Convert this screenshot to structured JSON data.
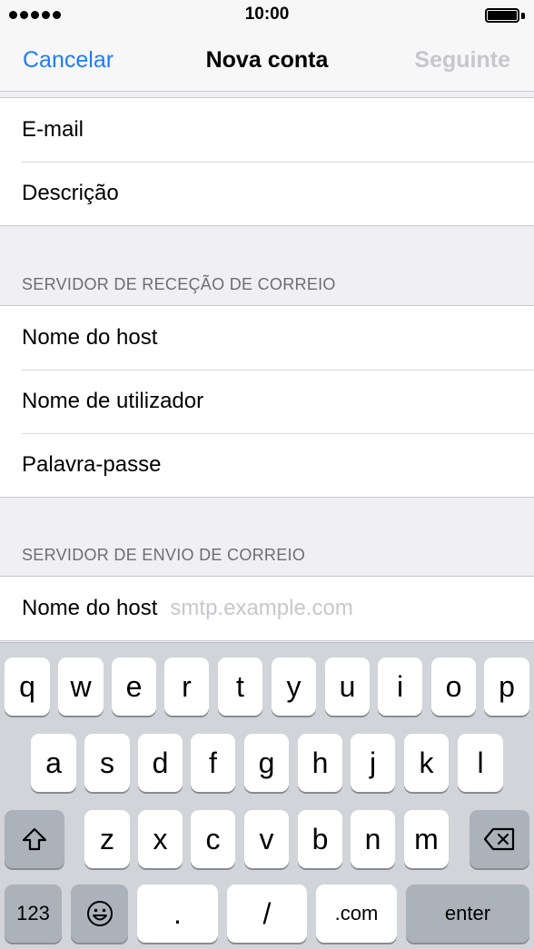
{
  "status_bar": {
    "time": "10:00",
    "signal_dots": 5
  },
  "nav": {
    "cancel": "Cancelar",
    "title": "Nova conta",
    "next": "Seguinte"
  },
  "account_group": {
    "rows": [
      "E-mail",
      "Descrição"
    ]
  },
  "incoming": {
    "header": "SERVIDOR DE RECEÇÃO DE CORREIO",
    "rows": [
      "Nome do host",
      "Nome de utilizador",
      "Palavra-passe"
    ]
  },
  "outgoing": {
    "header": "SERVIDOR DE ENVIO DE CORREIO",
    "host_label": "Nome do host",
    "host_placeholder": "smtp.example.com"
  },
  "keyboard": {
    "row1": [
      "q",
      "w",
      "e",
      "r",
      "t",
      "y",
      "u",
      "i",
      "o",
      "p"
    ],
    "row2": [
      "a",
      "s",
      "d",
      "f",
      "g",
      "h",
      "j",
      "k",
      "l"
    ],
    "row3": [
      "z",
      "x",
      "c",
      "v",
      "b",
      "n",
      "m"
    ],
    "numbers_key": "123",
    "dot_key": ".",
    "slash_key": "/",
    "dotcom_key": ".com",
    "enter_key": "enter",
    "icons": {
      "shift": "shift-icon",
      "delete": "backspace-icon",
      "emoji": "emoji-icon"
    }
  },
  "colors": {
    "accent": "#1f7cf7",
    "disabled": "#c7c7cc",
    "keyboard_bg": "#d1d4d9",
    "dark_key": "#acb2ba"
  }
}
